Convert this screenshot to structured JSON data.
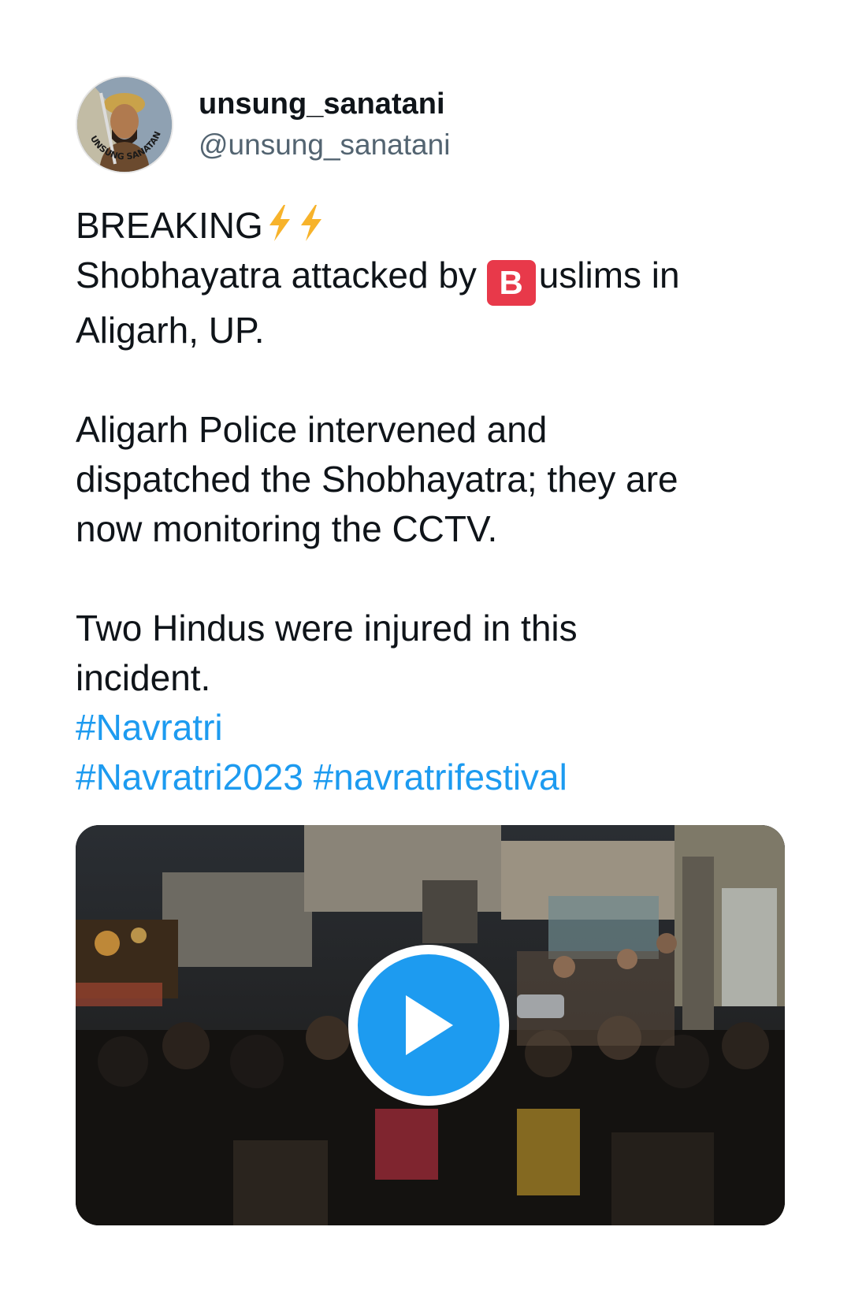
{
  "author": {
    "display_name": "unsung_sanatani",
    "handle": "@unsung_sanatani",
    "avatar_text": "UNSUNG SANATANI"
  },
  "tweet": {
    "line1": "BREAKING",
    "line2_before": "Shobhayatra attacked by ",
    "badge_letter": "B",
    "line2_after": "uslims in",
    "line3": "Aligarh, UP.",
    "line4": "Aligarh Police intervened and",
    "line5": "dispatched the Shobhayatra; they are",
    "line6": "now monitoring the CCTV.",
    "line7": "Two Hindus were injured in this",
    "line8": "incident.",
    "hashtags": [
      "#Navratri",
      "#Navratri2023",
      "#navratrifestival"
    ]
  },
  "media": {
    "type": "video",
    "icon": "play-icon"
  },
  "colors": {
    "text": "#0f1419",
    "secondary": "#536471",
    "hashtag": "#1d9bf0",
    "badge": "#e8394a",
    "bolt": "#f7b32b"
  }
}
